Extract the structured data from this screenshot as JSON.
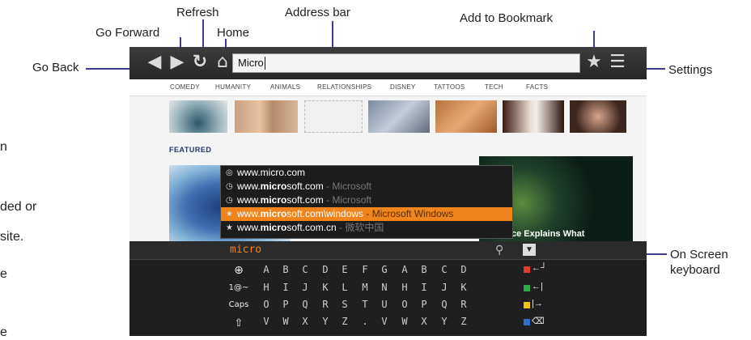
{
  "callouts": {
    "refresh": "Refresh",
    "address_bar": "Address bar",
    "add_bookmark": "Add to Bookmark",
    "go_forward": "Go Forward",
    "home": "Home",
    "go_back": "Go Back",
    "settings": "Settings",
    "on_screen": "On Screen",
    "keyboard": "keyboard"
  },
  "left_cut_text": [
    "n",
    "ded or",
    "site.",
    "e",
    "e"
  ],
  "browser": {
    "address_value": "Micro",
    "categories": [
      "COMEDY",
      "HUMANITY",
      "ANIMALS",
      "RELATIONSHIPS",
      "DISNEY",
      "TATTOOS",
      "TECH",
      "FACTS"
    ],
    "featured_label": "FEATURED",
    "overlay_caption": "ce Explains What"
  },
  "autocomplete": [
    {
      "icon": "search",
      "pre": "www.micro.com",
      "bold": "",
      "post": "",
      "sub": ""
    },
    {
      "icon": "history",
      "pre": "www.",
      "bold": "micro",
      "post": "soft.com",
      "sub": " - Microsoft"
    },
    {
      "icon": "history",
      "pre": "www.",
      "bold": "micro",
      "post": "soft.com",
      "sub": " - Microsoft"
    },
    {
      "icon": "star",
      "pre": "www.",
      "bold": "micro",
      "post": "soft.com\\windows",
      "sub": " - Microsoft Windows"
    },
    {
      "icon": "star",
      "pre": "www.",
      "bold": "micro",
      "post": "soft.com.cn",
      "sub": " - 微软中国"
    }
  ],
  "keyboard": {
    "input_value": "micro",
    "function_keys": [
      "",
      "1@~",
      "Caps",
      ""
    ],
    "rows": [
      [
        "A",
        "B",
        "C",
        "D",
        "E",
        "F",
        "G",
        "A",
        "B",
        "C",
        "D"
      ],
      [
        "H",
        "I",
        "J",
        "K",
        "L",
        "M",
        "N",
        "H",
        "I",
        "J",
        "K"
      ],
      [
        "O",
        "P",
        "Q",
        "R",
        "S",
        "T",
        "U",
        "O",
        "P",
        "Q",
        "R"
      ],
      [
        "V",
        "W",
        "X",
        "Y",
        "Z",
        ".",
        "V",
        "W",
        "X",
        "Y",
        "Z"
      ]
    ],
    "swatch_colors": [
      "#e03a2a",
      "#2eaa4a",
      "#f4c20d",
      "#2f6fd0"
    ],
    "action_glyphs": [
      "←┘",
      "←|",
      "|→",
      "⌫"
    ]
  }
}
